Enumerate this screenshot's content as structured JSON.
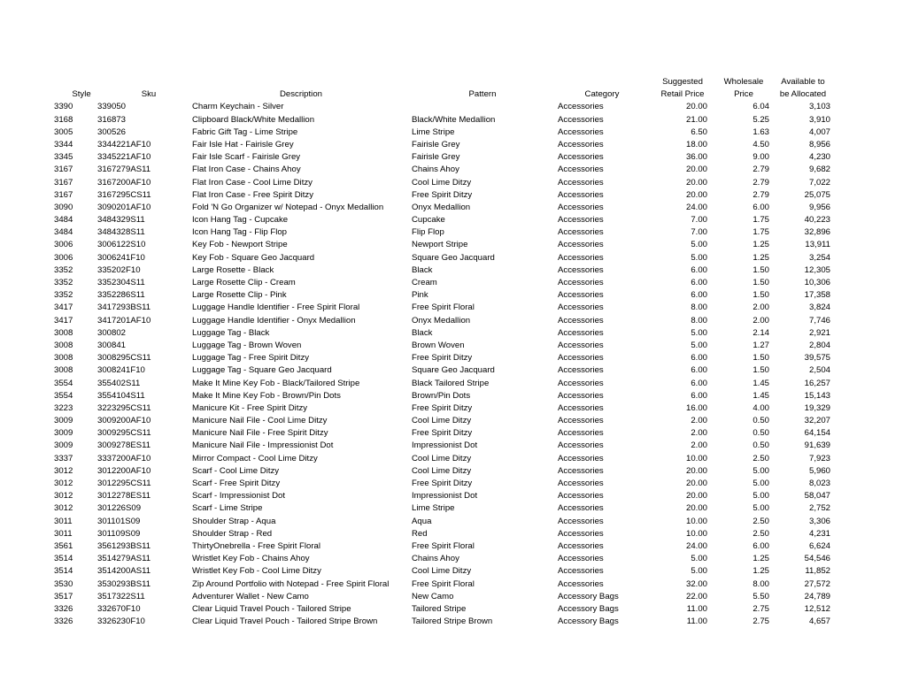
{
  "headers": {
    "top": {
      "style": "",
      "sku": "",
      "description": "",
      "pattern": "",
      "category": "",
      "srp": "Suggested",
      "wholesale": "Wholesale",
      "available": "Available to"
    },
    "bottom": {
      "style": "Style",
      "sku": "Sku",
      "description": "Description",
      "pattern": "Pattern",
      "category": "Category",
      "srp": "Retail Price",
      "wholesale": "Price",
      "available": "be Allocated"
    }
  },
  "rows": [
    {
      "style": "3390",
      "sku": "339050",
      "description": "Charm Keychain - Silver",
      "pattern": "",
      "category": "Accessories",
      "srp": "20.00",
      "wholesale": "6.04",
      "available": "3,103"
    },
    {
      "style": "3168",
      "sku": "316873",
      "description": "Clipboard Black/White Medallion",
      "pattern": "Black/White Medallion",
      "category": "Accessories",
      "srp": "21.00",
      "wholesale": "5.25",
      "available": "3,910"
    },
    {
      "style": "3005",
      "sku": "300526",
      "description": "Fabric Gift Tag - Lime Stripe",
      "pattern": "Lime Stripe",
      "category": "Accessories",
      "srp": "6.50",
      "wholesale": "1.63",
      "available": "4,007"
    },
    {
      "style": "3344",
      "sku": "3344221AF10",
      "description": "Fair Isle Hat - Fairisle Grey",
      "pattern": "Fairisle Grey",
      "category": "Accessories",
      "srp": "18.00",
      "wholesale": "4.50",
      "available": "8,956"
    },
    {
      "style": "3345",
      "sku": "3345221AF10",
      "description": "Fair Isle Scarf - Fairisle Grey",
      "pattern": "Fairisle Grey",
      "category": "Accessories",
      "srp": "36.00",
      "wholesale": "9.00",
      "available": "4,230"
    },
    {
      "style": "3167",
      "sku": "3167279AS11",
      "description": "Flat Iron Case - Chains Ahoy",
      "pattern": "Chains Ahoy",
      "category": "Accessories",
      "srp": "20.00",
      "wholesale": "2.79",
      "available": "9,682"
    },
    {
      "style": "3167",
      "sku": "3167200AF10",
      "description": "Flat Iron Case - Cool Lime Ditzy",
      "pattern": "Cool Lime Ditzy",
      "category": "Accessories",
      "srp": "20.00",
      "wholesale": "2.79",
      "available": "7,022"
    },
    {
      "style": "3167",
      "sku": "3167295CS11",
      "description": "Flat Iron Case - Free Spirit Ditzy",
      "pattern": "Free Spirit Ditzy",
      "category": "Accessories",
      "srp": "20.00",
      "wholesale": "2.79",
      "available": "25,075"
    },
    {
      "style": "3090",
      "sku": "3090201AF10",
      "description": "Fold 'N Go Organizer w/ Notepad - Onyx Medallion",
      "pattern": "Onyx Medallion",
      "category": "Accessories",
      "srp": "24.00",
      "wholesale": "6.00",
      "available": "9,956"
    },
    {
      "style": "3484",
      "sku": "3484329S11",
      "description": "Icon Hang Tag - Cupcake",
      "pattern": "Cupcake",
      "category": "Accessories",
      "srp": "7.00",
      "wholesale": "1.75",
      "available": "40,223"
    },
    {
      "style": "3484",
      "sku": "3484328S11",
      "description": "Icon Hang Tag - Flip Flop",
      "pattern": "Flip Flop",
      "category": "Accessories",
      "srp": "7.00",
      "wholesale": "1.75",
      "available": "32,896"
    },
    {
      "style": "3006",
      "sku": "3006122S10",
      "description": "Key Fob - Newport Stripe",
      "pattern": "Newport Stripe",
      "category": "Accessories",
      "srp": "5.00",
      "wholesale": "1.25",
      "available": "13,911"
    },
    {
      "style": "3006",
      "sku": "3006241F10",
      "description": "Key Fob - Square Geo Jacquard",
      "pattern": "Square Geo Jacquard",
      "category": "Accessories",
      "srp": "5.00",
      "wholesale": "1.25",
      "available": "3,254"
    },
    {
      "style": "3352",
      "sku": "335202F10",
      "description": "Large Rosette - Black",
      "pattern": "Black",
      "category": "Accessories",
      "srp": "6.00",
      "wholesale": "1.50",
      "available": "12,305"
    },
    {
      "style": "3352",
      "sku": "3352304S11",
      "description": "Large Rosette Clip - Cream",
      "pattern": "Cream",
      "category": "Accessories",
      "srp": "6.00",
      "wholesale": "1.50",
      "available": "10,306"
    },
    {
      "style": "3352",
      "sku": "3352286S11",
      "description": "Large Rosette Clip - Pink",
      "pattern": "Pink",
      "category": "Accessories",
      "srp": "6.00",
      "wholesale": "1.50",
      "available": "17,358"
    },
    {
      "style": "3417",
      "sku": "3417293BS11",
      "description": "Luggage Handle Identifier - Free Spirit Floral",
      "pattern": "Free Spirit Floral",
      "category": "Accessories",
      "srp": "8.00",
      "wholesale": "2.00",
      "available": "3,824"
    },
    {
      "style": "3417",
      "sku": "3417201AF10",
      "description": "Luggage Handle Identifier - Onyx Medallion",
      "pattern": "Onyx Medallion",
      "category": "Accessories",
      "srp": "8.00",
      "wholesale": "2.00",
      "available": "7,746"
    },
    {
      "style": "3008",
      "sku": "300802",
      "description": "Luggage Tag - Black",
      "pattern": "Black",
      "category": "Accessories",
      "srp": "5.00",
      "wholesale": "2.14",
      "available": "2,921"
    },
    {
      "style": "3008",
      "sku": "300841",
      "description": "Luggage Tag - Brown Woven",
      "pattern": "Brown Woven",
      "category": "Accessories",
      "srp": "5.00",
      "wholesale": "1.27",
      "available": "2,804"
    },
    {
      "style": "3008",
      "sku": "3008295CS11",
      "description": "Luggage Tag - Free Spirit Ditzy",
      "pattern": "Free Spirit Ditzy",
      "category": "Accessories",
      "srp": "6.00",
      "wholesale": "1.50",
      "available": "39,575"
    },
    {
      "style": "3008",
      "sku": "3008241F10",
      "description": "Luggage Tag - Square Geo Jacquard",
      "pattern": "Square Geo Jacquard",
      "category": "Accessories",
      "srp": "6.00",
      "wholesale": "1.50",
      "available": "2,504"
    },
    {
      "style": "3554",
      "sku": "355402S11",
      "description": "Make It Mine Key Fob - Black/Tailored Stripe",
      "pattern": "Black Tailored Stripe",
      "category": "Accessories",
      "srp": "6.00",
      "wholesale": "1.45",
      "available": "16,257"
    },
    {
      "style": "3554",
      "sku": "3554104S11",
      "description": "Make It Mine Key Fob - Brown/Pin Dots",
      "pattern": "Brown/Pin Dots",
      "category": "Accessories",
      "srp": "6.00",
      "wholesale": "1.45",
      "available": "15,143"
    },
    {
      "style": "3223",
      "sku": "3223295CS11",
      "description": "Manicure Kit - Free Spirit Ditzy",
      "pattern": "Free Spirit Ditzy",
      "category": "Accessories",
      "srp": "16.00",
      "wholesale": "4.00",
      "available": "19,329"
    },
    {
      "style": "3009",
      "sku": "3009200AF10",
      "description": "Manicure Nail File - Cool Lime Ditzy",
      "pattern": "Cool Lime Ditzy",
      "category": "Accessories",
      "srp": "2.00",
      "wholesale": "0.50",
      "available": "32,207"
    },
    {
      "style": "3009",
      "sku": "3009295CS11",
      "description": "Manicure Nail File - Free Spirit Ditzy",
      "pattern": "Free Spirit Ditzy",
      "category": "Accessories",
      "srp": "2.00",
      "wholesale": "0.50",
      "available": "64,154"
    },
    {
      "style": "3009",
      "sku": "3009278ES11",
      "description": "Manicure Nail File - Impressionist Dot",
      "pattern": "Impressionist Dot",
      "category": "Accessories",
      "srp": "2.00",
      "wholesale": "0.50",
      "available": "91,639"
    },
    {
      "style": "3337",
      "sku": "3337200AF10",
      "description": "Mirror Compact - Cool Lime Ditzy",
      "pattern": "Cool Lime Ditzy",
      "category": "Accessories",
      "srp": "10.00",
      "wholesale": "2.50",
      "available": "7,923"
    },
    {
      "style": "3012",
      "sku": "3012200AF10",
      "description": "Scarf - Cool Lime Ditzy",
      "pattern": "Cool Lime Ditzy",
      "category": "Accessories",
      "srp": "20.00",
      "wholesale": "5.00",
      "available": "5,960"
    },
    {
      "style": "3012",
      "sku": "3012295CS11",
      "description": "Scarf - Free Spirit Ditzy",
      "pattern": "Free Spirit Ditzy",
      "category": "Accessories",
      "srp": "20.00",
      "wholesale": "5.00",
      "available": "8,023"
    },
    {
      "style": "3012",
      "sku": "3012278ES11",
      "description": "Scarf - Impressionist Dot",
      "pattern": "Impressionist Dot",
      "category": "Accessories",
      "srp": "20.00",
      "wholesale": "5.00",
      "available": "58,047"
    },
    {
      "style": "3012",
      "sku": "301226S09",
      "description": "Scarf - Lime Stripe",
      "pattern": "Lime Stripe",
      "category": "Accessories",
      "srp": "20.00",
      "wholesale": "5.00",
      "available": "2,752"
    },
    {
      "style": "3011",
      "sku": "301101S09",
      "description": "Shoulder Strap - Aqua",
      "pattern": "Aqua",
      "category": "Accessories",
      "srp": "10.00",
      "wholesale": "2.50",
      "available": "3,306"
    },
    {
      "style": "3011",
      "sku": "301109S09",
      "description": "Shoulder Strap - Red",
      "pattern": "Red",
      "category": "Accessories",
      "srp": "10.00",
      "wholesale": "2.50",
      "available": "4,231"
    },
    {
      "style": "3561",
      "sku": "3561293BS11",
      "description": "ThirtyOnebrella - Free Spirit Floral",
      "pattern": "Free Spirit Floral",
      "category": "Accessories",
      "srp": "24.00",
      "wholesale": "6.00",
      "available": "6,624"
    },
    {
      "style": "3514",
      "sku": "3514279AS11",
      "description": "Wristlet Key Fob - Chains Ahoy",
      "pattern": "Chains Ahoy",
      "category": "Accessories",
      "srp": "5.00",
      "wholesale": "1.25",
      "available": "54,546"
    },
    {
      "style": "3514",
      "sku": "3514200AS11",
      "description": "Wristlet Key Fob - Cool Lime Ditzy",
      "pattern": "Cool Lime Ditzy",
      "category": "Accessories",
      "srp": "5.00",
      "wholesale": "1.25",
      "available": "11,852"
    },
    {
      "style": "3530",
      "sku": "3530293BS11",
      "description": "Zip Around Portfolio with Notepad - Free Spirit Floral",
      "pattern": "Free Spirit Floral",
      "category": "Accessories",
      "srp": "32.00",
      "wholesale": "8.00",
      "available": "27,572"
    },
    {
      "style": "3517",
      "sku": "3517322S11",
      "description": "Adventurer Wallet - New Camo",
      "pattern": "New Camo",
      "category": "Accessory Bags",
      "srp": "22.00",
      "wholesale": "5.50",
      "available": "24,789"
    },
    {
      "style": "3326",
      "sku": "332670F10",
      "description": "Clear Liquid Travel Pouch - Tailored Stripe",
      "pattern": "Tailored Stripe",
      "category": "Accessory Bags",
      "srp": "11.00",
      "wholesale": "2.75",
      "available": "12,512"
    },
    {
      "style": "3326",
      "sku": "3326230F10",
      "description": "Clear Liquid Travel Pouch - Tailored Stripe Brown",
      "pattern": "Tailored Stripe Brown",
      "category": "Accessory Bags",
      "srp": "11.00",
      "wholesale": "2.75",
      "available": "4,657"
    }
  ]
}
